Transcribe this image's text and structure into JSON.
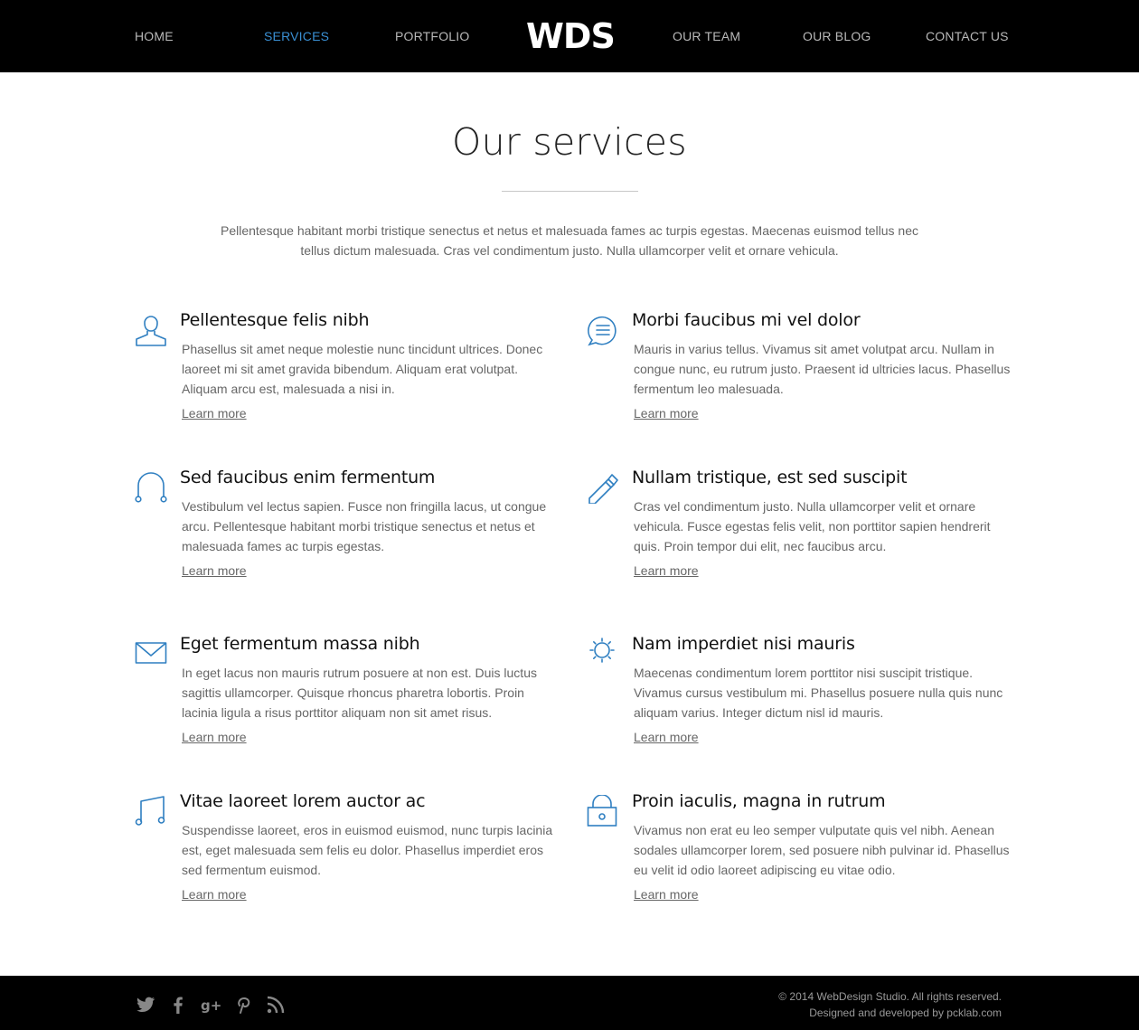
{
  "header": {
    "nav_left": [
      "HOME",
      "SERVICES",
      "PORTFOLIO"
    ],
    "logo": "WDS",
    "nav_right": [
      "OUR TEAM",
      "OUR BLOG",
      "CONTACT US"
    ],
    "active_item": "SERVICES"
  },
  "intro": {
    "title": "Our services",
    "text": "Pellentesque habitant morbi tristique senectus et netus et malesuada fames ac turpis egestas. Maecenas euismod tellus nec tellus dictum malesuada. Cras vel condimentum justo. Nulla ullamcorper velit et ornare vehicula."
  },
  "services": [
    {
      "icon": "user-icon",
      "title": "Pellentesque felis nibh",
      "text": "Phasellus sit amet neque molestie nunc tincidunt ultrices. Donec laoreet mi sit amet gravida bibendum. Aliquam erat volutpat. Aliquam arcu est, malesuada a nisi in.",
      "link": "Learn more"
    },
    {
      "icon": "chat-bubble-icon",
      "title": "Morbi faucibus mi vel dolor",
      "text": "Mauris in varius tellus. Vivamus sit amet volutpat arcu. Nullam in congue nunc, eu rutrum justo. Praesent id ultricies lacus. Phasellus fermentum leo malesuada.",
      "link": "Learn more"
    },
    {
      "icon": "headphones-icon",
      "title": "Sed faucibus enim fermentum",
      "text": "Vestibulum vel lectus sapien. Fusce non fringilla lacus, ut congue arcu. Pellentesque habitant morbi tristique senectus et netus et malesuada fames ac turpis egestas.",
      "link": "Learn more"
    },
    {
      "icon": "pencil-icon",
      "title": "Nullam tristique, est sed suscipit",
      "text": "Cras vel condimentum justo. Nulla ullamcorper velit et ornare vehicula. Fusce egestas felis velit, non porttitor sapien hendrerit quis. Proin tempor dui elit, nec faucibus arcu.",
      "link": "Learn more"
    },
    {
      "icon": "envelope-icon",
      "title": "Eget fermentum massa nibh",
      "text": "In eget lacus non mauris rutrum posuere at non est. Duis luctus sagittis ullamcorper. Quisque rhoncus pharetra lobortis. Proin lacinia ligula a risus porttitor aliquam non sit amet risus.",
      "link": "Learn more"
    },
    {
      "icon": "sun-icon",
      "title": "Nam imperdiet nisi mauris",
      "text": "Maecenas condimentum lorem porttitor nisi suscipit tristique. Vivamus cursus vestibulum mi. Phasellus posuere nulla quis nunc aliquam varius. Integer dictum nisl id mauris.",
      "link": "Learn more"
    },
    {
      "icon": "music-note-icon",
      "title": "Vitae laoreet lorem auctor ac",
      "text": "Suspendisse laoreet, eros in euismod euismod, nunc turpis lacinia est, eget malesuada sem felis eu dolor. Phasellus imperdiet eros sed fermentum euismod.",
      "link": "Learn more"
    },
    {
      "icon": "lock-icon",
      "title": "Proin iaculis, magna in rutrum",
      "text": "Vivamus non erat eu leo semper vulputate quis vel nibh. Aenean sodales ullamcorper lorem, sed posuere nibh pulvinar id. Phasellus eu velit id odio laoreet adipiscing eu vitae odio.",
      "link": "Learn more"
    }
  ],
  "footer": {
    "social_icons": [
      "twitter-icon",
      "facebook-icon",
      "google-plus-icon",
      "pinterest-icon",
      "rss-icon"
    ],
    "copyright": "© 2014 WebDesign Studio. All rights reserved.",
    "credit": "Designed and developed by pcklab.com"
  },
  "colors": {
    "accent": "#3a8fd3",
    "icon": "#2f7fc1",
    "header_bg": "#000000",
    "nav_text": "#b8b8b8"
  }
}
